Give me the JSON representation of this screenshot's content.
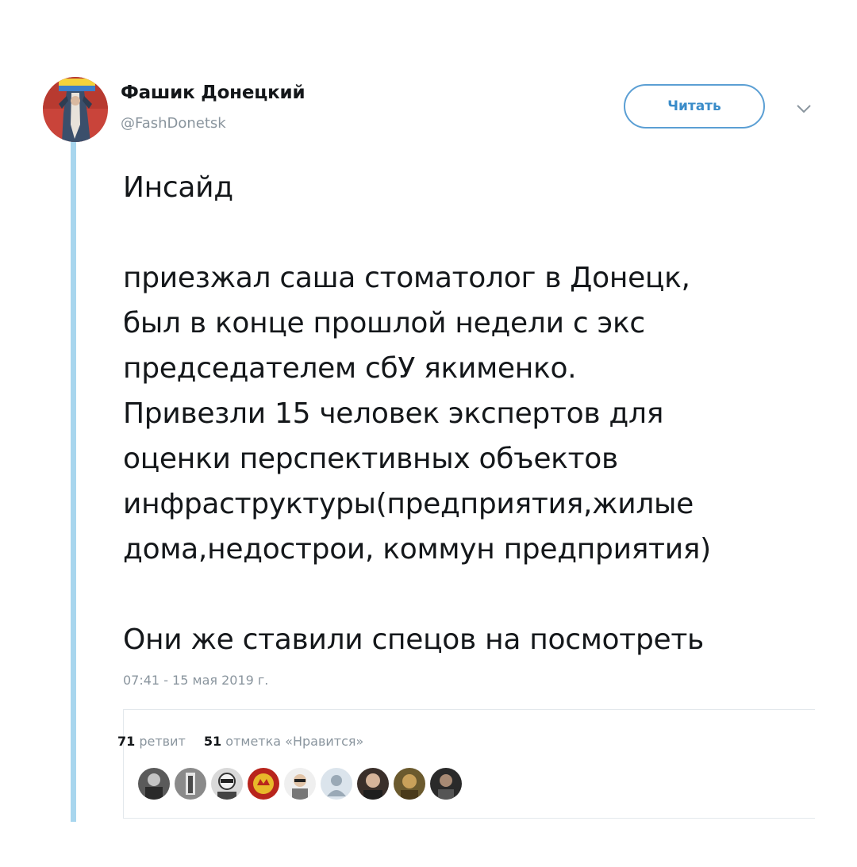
{
  "author": {
    "name": "Фашик Донецкий",
    "handle": "@FashDonetsk",
    "avatar_icon": "avatar-flag-figure"
  },
  "follow_button": {
    "label": "Читать"
  },
  "menu": {
    "icon": "chevron-down-icon"
  },
  "tweet": {
    "paragraphs": [
      [
        "Инсайд"
      ],
      [
        "приезжал саша стоматолог в Донецк,",
        "был в конце прошлой недели с экс",
        "председателем сбУ якименко.",
        "Привезли 15 человек экспертов для",
        "оценки перспективных объектов",
        "инфраструктуры(предприятия,жилые",
        "дома,недострои, коммун предприятия)"
      ],
      [
        "Они же ставили спецов на посмотреть"
      ]
    ],
    "timestamp": "07:41 - 15 мая 2019 г."
  },
  "stats": {
    "retweets_count": "71",
    "retweets_label": "ретвит",
    "likes_count": "51",
    "likes_label": "отметка «Нравится»"
  },
  "likers": [
    {
      "icon": "avatar-photo"
    },
    {
      "icon": "avatar-photo"
    },
    {
      "icon": "avatar-photo"
    },
    {
      "icon": "avatar-emblem"
    },
    {
      "icon": "avatar-photo"
    },
    {
      "icon": "avatar-default"
    },
    {
      "icon": "avatar-photo"
    },
    {
      "icon": "avatar-photo"
    },
    {
      "icon": "avatar-photo"
    }
  ],
  "colors": {
    "accent": "#3a8cc9",
    "thread_line": "#a8d6ee",
    "secondary_text": "#8a959e",
    "primary_text": "#14171a"
  }
}
